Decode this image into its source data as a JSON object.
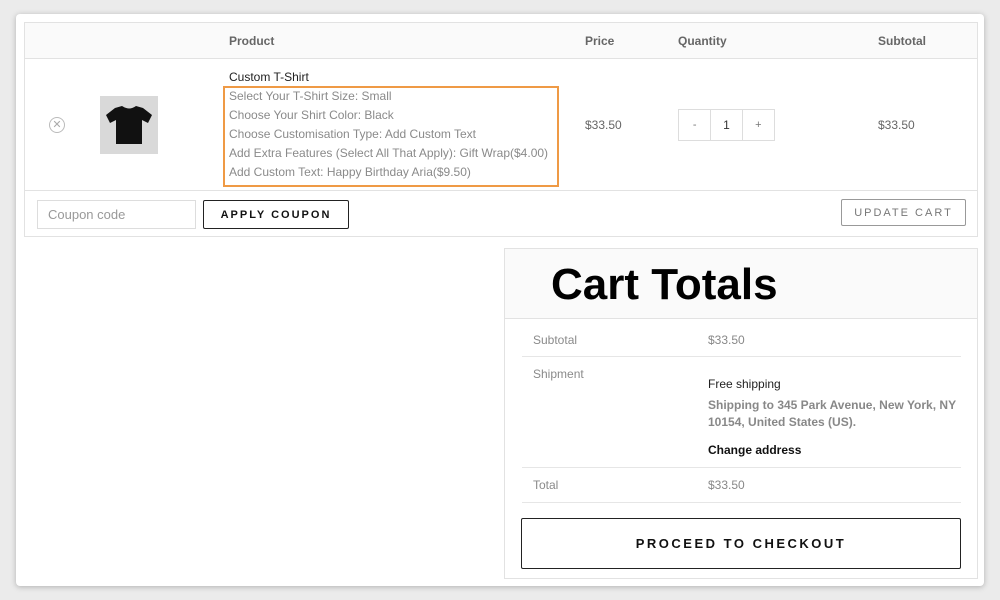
{
  "table": {
    "headers": {
      "product": "Product",
      "price": "Price",
      "quantity": "Quantity",
      "subtotal": "Subtotal"
    }
  },
  "item": {
    "remove_icon": "x-circle-icon",
    "thumbnail_icon": "tshirt-icon",
    "thumbnail_color": "#111111",
    "name": "Custom T-Shirt",
    "meta": [
      "Select Your T-Shirt Size: Small",
      "Choose Your Shirt Color: Black",
      "Choose Customisation Type: Add Custom Text",
      "Add Extra Features (Select All That Apply): Gift Wrap($4.00)",
      "Add Custom Text: Happy Birthday Aria($9.50)"
    ],
    "price": "$33.50",
    "quantity": "1",
    "qty_minus": "-",
    "qty_plus": "+",
    "subtotal": "$33.50"
  },
  "highlight_color": "#ef9a45",
  "actions": {
    "coupon_placeholder": "Coupon code",
    "apply_label": "APPLY COUPON",
    "update_label": "UPDATE CART"
  },
  "totals": {
    "title": "Cart Totals",
    "subtotal_label": "Subtotal",
    "subtotal_value": "$33.50",
    "shipment_label": "Shipment",
    "shipping_method": "Free shipping",
    "shipping_address": "Shipping to 345 Park Avenue, New York, NY 10154, United States (US).",
    "change_address": "Change address",
    "total_label": "Total",
    "total_value": "$33.50",
    "checkout_label": "PROCEED TO CHECKOUT"
  }
}
